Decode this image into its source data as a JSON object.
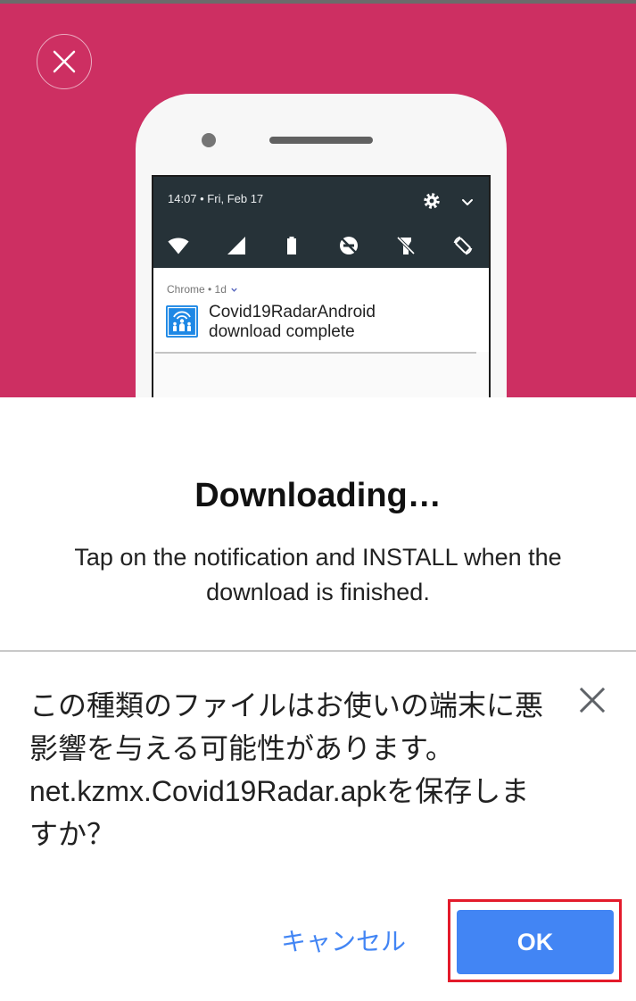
{
  "hero": {
    "background_color": "#cd2f62",
    "close_icon": "close-icon",
    "phone": {
      "status_text": "14:07 • Fri, Feb 17",
      "header_icons": [
        "gear-icon",
        "chevron-down-icon"
      ],
      "quick_settings_icons": [
        "wifi-icon",
        "signal-icon",
        "battery-icon",
        "do-not-disturb-icon",
        "flashlight-icon",
        "auto-rotate-icon"
      ],
      "notification": {
        "header": "Chrome • 1d",
        "app_icon": "covid-radar-app-icon",
        "title": "Covid19RadarAndroid",
        "text": "download complete"
      }
    }
  },
  "instructions": {
    "title": "Downloading…",
    "body": "Tap on the notification and INSTALL when the download is finished."
  },
  "dialog": {
    "message_lines": [
      "この種類のファイルはお使いの端末に悪",
      "影響を与える可能性があります。",
      "net.kzmx.Covid19Radar.apkを保存しま",
      "すか？"
    ],
    "close_icon": "close-icon",
    "cancel_label": "キャンセル",
    "ok_label": "OK",
    "accent_color": "#4285f4",
    "highlight_color": "#e31b2b"
  }
}
